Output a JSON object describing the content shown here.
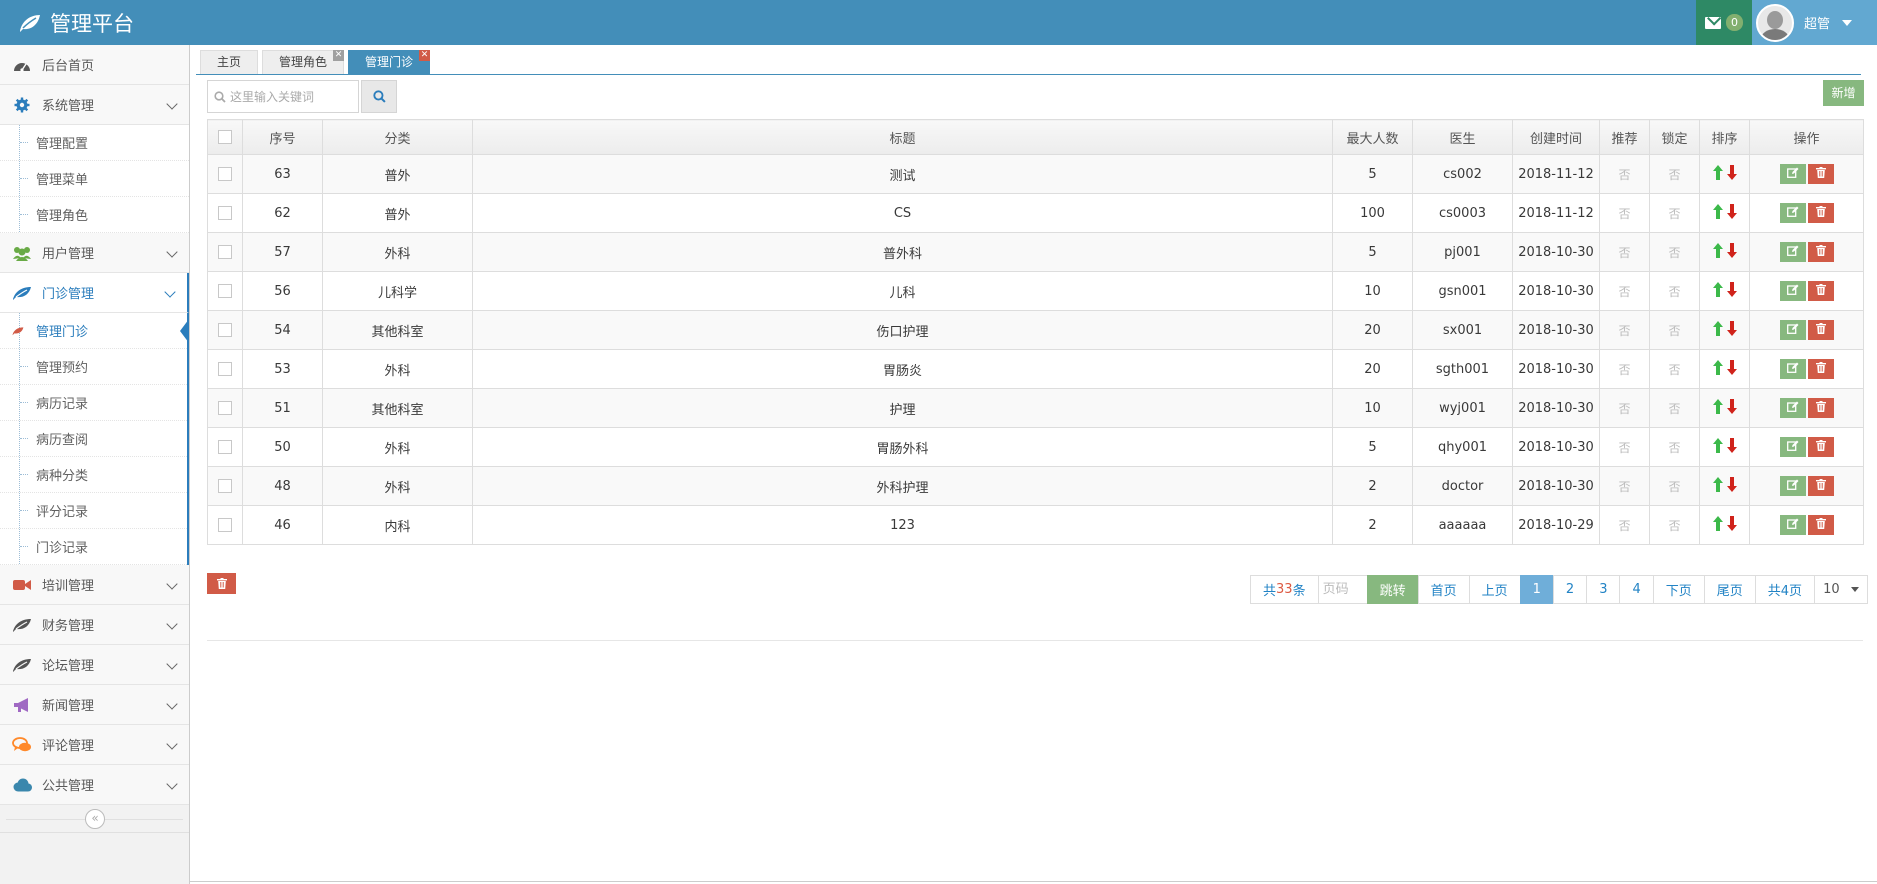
{
  "app": {
    "title": "管理平台"
  },
  "header": {
    "message_count": "0",
    "user_name": "超管"
  },
  "sidebar": {
    "items": [
      {
        "label": "后台首页",
        "icon": "dashboard-icon",
        "color": "#585858"
      },
      {
        "label": "系统管理",
        "icon": "gear-icon",
        "color": "#2b7dbc",
        "children": [
          "管理配置",
          "管理菜单",
          "管理角色"
        ]
      },
      {
        "label": "用户管理",
        "icon": "users-icon",
        "color": "#69aa46"
      },
      {
        "label": "门诊管理",
        "icon": "leaf-icon",
        "color": "#2b7dbc",
        "children": [
          "管理门诊",
          "管理预约",
          "病历记录",
          "病历查阅",
          "病种分类",
          "评分记录",
          "门诊记录"
        ]
      },
      {
        "label": "培训管理",
        "icon": "video-camera-icon",
        "color": "#d15b47"
      },
      {
        "label": "财务管理",
        "icon": "leaf-icon",
        "color": "#555555"
      },
      {
        "label": "论坛管理",
        "icon": "leaf-icon",
        "color": "#555555"
      },
      {
        "label": "新闻管理",
        "icon": "bullhorn-icon",
        "color": "#a069c3"
      },
      {
        "label": "评论管理",
        "icon": "comments-icon",
        "color": "#ff892a"
      },
      {
        "label": "公共管理",
        "icon": "cloud-icon",
        "color": "#3a87ad"
      }
    ],
    "collapse_label": "«"
  },
  "tabs": [
    {
      "label": "主页",
      "closable": false,
      "active": false
    },
    {
      "label": "管理角色",
      "closable": true,
      "active": false
    },
    {
      "label": "管理门诊",
      "closable": true,
      "active": true
    }
  ],
  "toolbar": {
    "search_placeholder": "这里输入关键词",
    "add_label": "新增"
  },
  "table": {
    "columns": [
      "序号",
      "分类",
      "标题",
      "最大人数",
      "医生",
      "创建时间",
      "推荐",
      "锁定",
      "排序",
      "操作"
    ],
    "rows": [
      {
        "id": "63",
        "category": "普外",
        "title": "测试",
        "max": "5",
        "doctor": "cs002",
        "created": "2018-11-12",
        "recommend": "否",
        "locked": "否"
      },
      {
        "id": "62",
        "category": "普外",
        "title": "CS",
        "max": "100",
        "doctor": "cs0003",
        "created": "2018-11-12",
        "recommend": "否",
        "locked": "否"
      },
      {
        "id": "57",
        "category": "外科",
        "title": "普外科",
        "max": "5",
        "doctor": "pj001",
        "created": "2018-10-30",
        "recommend": "否",
        "locked": "否"
      },
      {
        "id": "56",
        "category": "儿科学",
        "title": "儿科",
        "max": "10",
        "doctor": "gsn001",
        "created": "2018-10-30",
        "recommend": "否",
        "locked": "否"
      },
      {
        "id": "54",
        "category": "其他科室",
        "title": "伤口护理",
        "max": "20",
        "doctor": "sx001",
        "created": "2018-10-30",
        "recommend": "否",
        "locked": "否"
      },
      {
        "id": "53",
        "category": "外科",
        "title": "胃肠炎",
        "max": "20",
        "doctor": "sgth001",
        "created": "2018-10-30",
        "recommend": "否",
        "locked": "否"
      },
      {
        "id": "51",
        "category": "其他科室",
        "title": "护理",
        "max": "10",
        "doctor": "wyj001",
        "created": "2018-10-30",
        "recommend": "否",
        "locked": "否"
      },
      {
        "id": "50",
        "category": "外科",
        "title": "胃肠外科",
        "max": "5",
        "doctor": "qhy001",
        "created": "2018-10-30",
        "recommend": "否",
        "locked": "否"
      },
      {
        "id": "48",
        "category": "外科",
        "title": "外科护理",
        "max": "2",
        "doctor": "doctor",
        "created": "2018-10-30",
        "recommend": "否",
        "locked": "否"
      },
      {
        "id": "46",
        "category": "内科",
        "title": "123",
        "max": "2",
        "doctor": "aaaaaa",
        "created": "2018-10-29",
        "recommend": "否",
        "locked": "否"
      }
    ]
  },
  "pager": {
    "total_prefix": "共",
    "total_count": "33",
    "total_suffix": "条",
    "page_placeholder": "页码",
    "jump_label": "跳转",
    "first_label": "首页",
    "prev_label": "上页",
    "pages": [
      "1",
      "2",
      "3",
      "4"
    ],
    "current_page": "1",
    "next_label": "下页",
    "last_label": "尾页",
    "page_count_label": "共4页",
    "page_size": "10"
  },
  "colors": {
    "navbar": "#438eb9",
    "accent": "#2b7dbc",
    "success": "#87b87f",
    "danger": "#d15b47",
    "message_bg": "#2e8965",
    "user_bg": "#62a8d1"
  }
}
